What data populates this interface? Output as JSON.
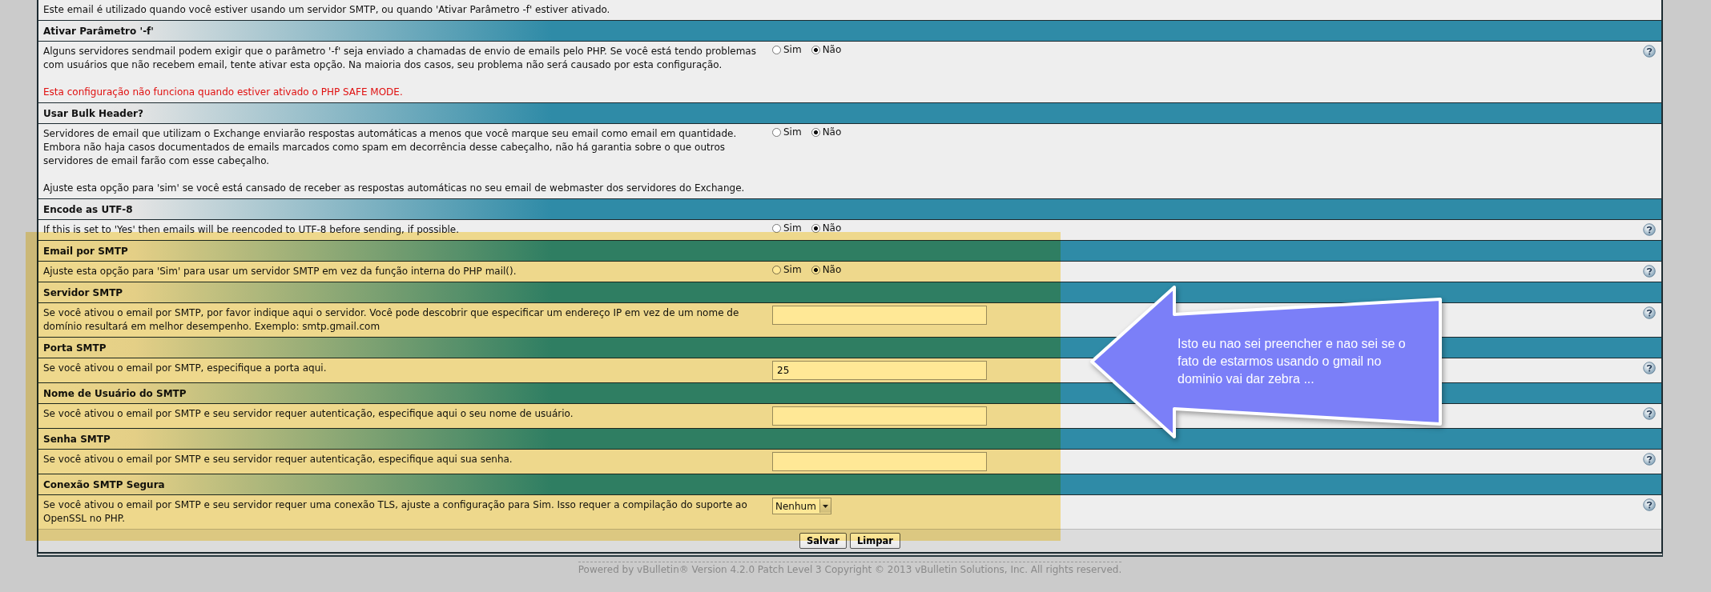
{
  "settings": [
    {
      "description": [
        {
          "kind": "note",
          "text": "Este email é utilizado quando você estiver usando um servidor SMTP, ou quando 'Ativar Parâmetro -f' estiver ativado."
        }
      ],
      "help": false
    },
    {
      "title": "Ativar Parâmetro '-f'",
      "description": [
        {
          "kind": "note",
          "text": "Alguns servidores sendmail podem exigir que o parâmetro '-f' seja enviado a chamadas de envio de emails pelo PHP. Se você está tendo problemas com usuários que não recebem email, tente ativar esta opção. Na maioria dos casos, seu problema não será causado por esta configuração."
        },
        {
          "kind": "warning",
          "text": "Esta configuração não funciona quando estiver ativado o PHP SAFE MODE."
        }
      ],
      "control": {
        "kind": "radio",
        "options": [
          {
            "label": "Sim",
            "selected": false
          },
          {
            "label": "Não",
            "selected": true
          }
        ]
      },
      "help": true
    },
    {
      "title": "Usar Bulk Header?",
      "description": [
        {
          "kind": "note",
          "text": "Servidores de email que utilizam o Exchange enviarão respostas automáticas a menos que você marque seu email como email em quantidade. Embora não haja casos documentados de emails marcados como spam em decorrência desse cabeçalho, não há garantia sobre o que outros servidores de email farão com esse cabeçalho."
        },
        {
          "kind": "note",
          "text": "Ajuste esta opção para 'sim' se você está cansado de receber as respostas automáticas no seu email de webmaster dos servidores do Exchange."
        }
      ],
      "control": {
        "kind": "radio",
        "options": [
          {
            "label": "Sim",
            "selected": false
          },
          {
            "label": "Não",
            "selected": true
          }
        ]
      },
      "help": false
    },
    {
      "title": "Encode as UTF-8",
      "description": [
        {
          "kind": "note",
          "text": "If this is set to 'Yes' then emails will be reencoded to UTF-8 before sending, if possible."
        }
      ],
      "control": {
        "kind": "radio",
        "options": [
          {
            "label": "Sim",
            "selected": false
          },
          {
            "label": "Não",
            "selected": true
          }
        ]
      },
      "help": true
    },
    {
      "title": "Email por SMTP",
      "description": [
        {
          "kind": "note",
          "text": "Ajuste esta opção para 'Sim' para usar um servidor SMTP em vez da função interna do PHP mail()."
        }
      ],
      "control": {
        "kind": "radio",
        "options": [
          {
            "label": "Sim",
            "selected": false
          },
          {
            "label": "Não",
            "selected": true
          }
        ]
      },
      "help": true
    },
    {
      "title": "Servidor SMTP",
      "description": [
        {
          "kind": "note",
          "text": "Se você ativou o email por SMTP, por favor indique aqui o servidor. Você pode descobrir que especificar um endereço IP em vez de um nome de domínio resultará em melhor desempenho. Exemplo: smtp.gmail.com"
        }
      ],
      "control": {
        "kind": "text"
      },
      "help": true
    },
    {
      "title": "Porta SMTP",
      "description": [
        {
          "kind": "note",
          "text": "Se você ativou o email por SMTP, especifique a porta aqui."
        }
      ],
      "control": {
        "kind": "text",
        "value": "25"
      },
      "help": true
    },
    {
      "title": "Nome de Usuário do SMTP",
      "description": [
        {
          "kind": "note",
          "text": "Se você ativou o email por SMTP e seu servidor requer autenticação, especifique aqui o seu nome de usuário."
        }
      ],
      "control": {
        "kind": "text"
      },
      "help": true
    },
    {
      "title": "Senha SMTP",
      "description": [
        {
          "kind": "note",
          "text": "Se você ativou o email por SMTP e seu servidor requer autenticação, especifique aqui sua senha."
        }
      ],
      "control": {
        "kind": "text"
      },
      "help": true
    },
    {
      "title": "Conexão SMTP Segura",
      "description": [
        {
          "kind": "note",
          "text": "Se você ativou o email por SMTP e seu servidor requer uma conexão TLS, ajuste a configuração para Sim. Isso requer a compilação do suporte ao OpenSSL no PHP."
        }
      ],
      "control": {
        "kind": "select",
        "value": "Nenhum"
      },
      "help": true
    }
  ],
  "buttons": [
    "Salvar",
    "Limpar"
  ],
  "callout": {
    "text": "Isto eu nao sei preencher e nao sei se o fato de estarmos usando o gmail no dominio vai dar zebra ..."
  },
  "footer": "Powered by vBulletin® Version 4.2.0 Patch Level 3 Copyright © 2013 vBulletin Solutions, Inc. All rights reserved."
}
